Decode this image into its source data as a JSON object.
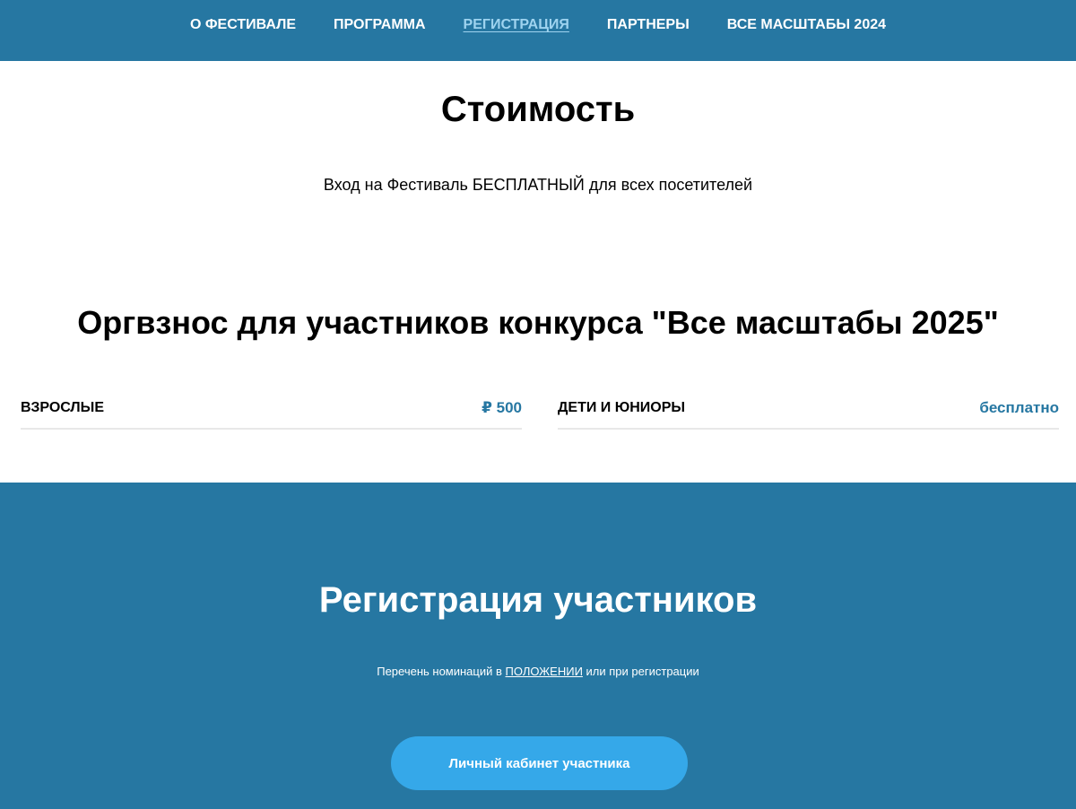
{
  "nav": {
    "items": [
      {
        "label": "О ФЕСТИВАЛЕ"
      },
      {
        "label": "ПРОГРАММА"
      },
      {
        "label": "РЕГИСТРАЦИЯ",
        "active": true
      },
      {
        "label": "ПАРТНЕРЫ"
      },
      {
        "label": "ВСЕ МАСШТАБЫ 2024"
      }
    ]
  },
  "pricing": {
    "title": "Стоимость",
    "free_note": "Вход на Фестиваль БЕСПЛАТНЫЙ для всех посетителей",
    "fee_title": "Оргвзнос для участников конкурса \"Все масштабы 2025\"",
    "rows": [
      {
        "label": "ВЗРОСЛЫЕ",
        "value": "₽ 500"
      },
      {
        "label": "ДЕТИ И ЮНИОРЫ",
        "value": "бесплатно"
      }
    ]
  },
  "registration": {
    "title": "Регистрация участников",
    "nominations_before": "Перечень номинаций в ",
    "nominations_link": "ПОЛОЖЕНИИ",
    "nominations_after": " или при регистрации",
    "button_label": "Личный кабинет участника"
  },
  "colors": {
    "primary": "#2677a2",
    "button": "#35a8e9",
    "active_link": "#9ed3ef"
  }
}
